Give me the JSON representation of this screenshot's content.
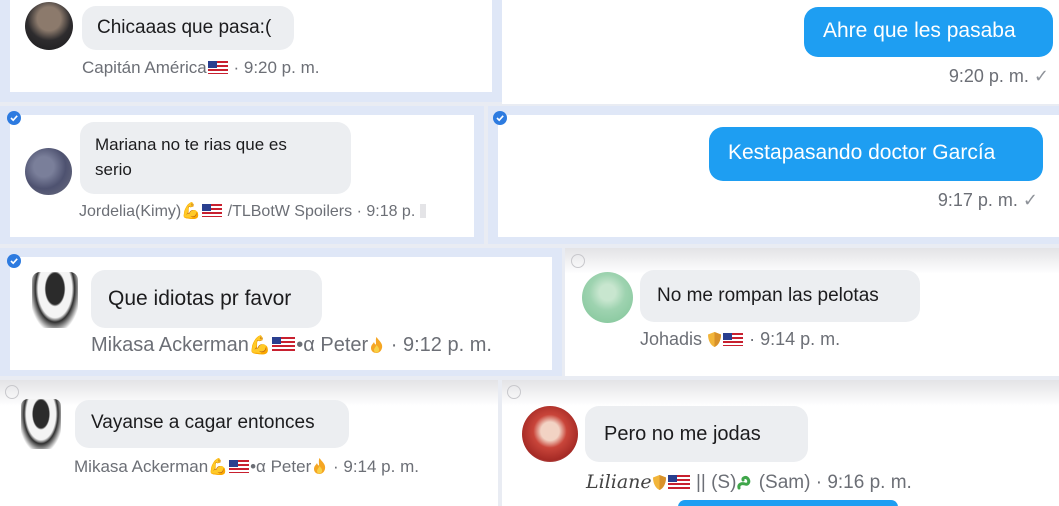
{
  "messages": [
    {
      "text": "Chicaaas que pasa:(",
      "sender": "Capitán América",
      "time": "9:20 p. m."
    },
    {
      "text": "Ahre que les pasaba",
      "time": "9:20 p. m.",
      "status": "✓"
    },
    {
      "text_line1": "Mariana no te rias que es",
      "text_line2": "serio",
      "sender": "Jordelia(Kimy)",
      "suffix": "/TLBotW Spoilers",
      "time": "9:18 p."
    },
    {
      "text": "Kestapasando doctor García",
      "time": "9:17 p. m.",
      "status": "✓"
    },
    {
      "text": "Que idiotas pr favor",
      "sender": "Mikasa Ackerman",
      "suffix": "•α Peter",
      "time": "9:12 p. m."
    },
    {
      "text": "No me rompan las pelotas",
      "sender": "Johadis",
      "time": "9:14 p. m."
    },
    {
      "text": "Vayanse a cagar entonces",
      "sender": "Mikasa Ackerman",
      "suffix": "•α Peter",
      "time": "9:14 p. m."
    },
    {
      "text": "Pero no me jodas",
      "sender": "Liliane",
      "suffix": "|| (S)",
      "suffix2": "(Sam)",
      "time": "9:16 p. m."
    }
  ],
  "separator": "·",
  "icons": [
    "avatar",
    "checkmark-icon",
    "selection-ring-icon",
    "flag-us-icon",
    "arm-emoji-icon",
    "shield-emoji-icon",
    "fire-emoji-icon",
    "snake-emoji-icon"
  ],
  "colors": {
    "outgoing_bubble": "#1e9ef2",
    "incoming_bubble": "#eceef1",
    "selection": "#dfe7f7",
    "check": "#2d7be0",
    "meta_text": "#6c6f76"
  }
}
